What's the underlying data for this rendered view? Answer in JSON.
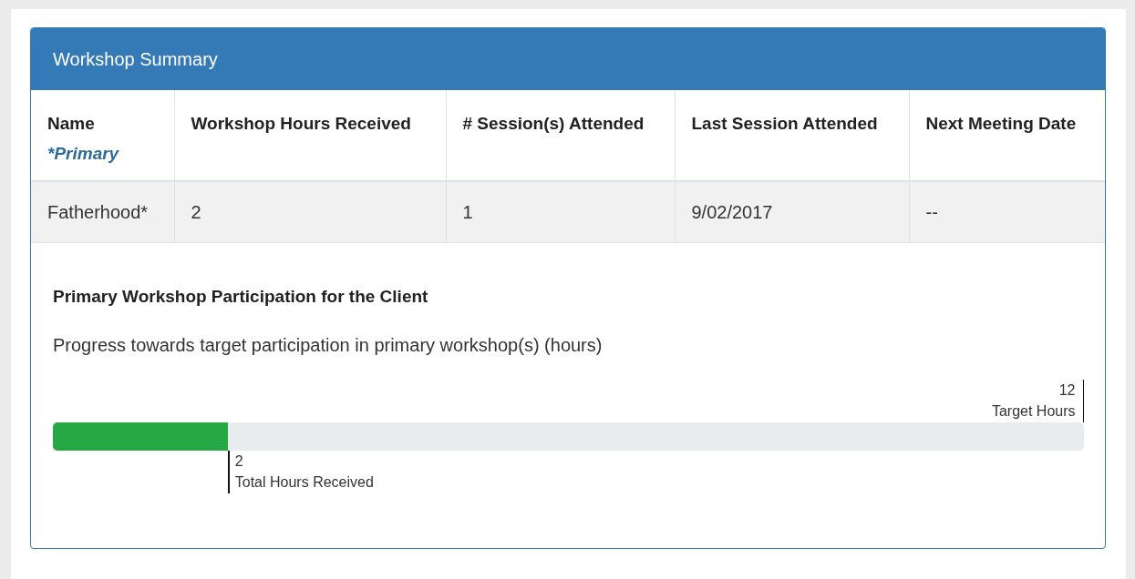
{
  "panel": {
    "title": "Workshop Summary"
  },
  "table": {
    "columns": [
      {
        "label": "Name",
        "note": "*Primary"
      },
      {
        "label": "Workshop Hours Received"
      },
      {
        "label": "# Session(s) Attended"
      },
      {
        "label": "Last Session Attended"
      },
      {
        "label": "Next Meeting Date"
      }
    ],
    "rows": [
      {
        "cells": [
          "Fatherhood*",
          "2",
          "1",
          "9/02/2017",
          "--"
        ]
      }
    ]
  },
  "participation": {
    "heading": "Primary Workshop Participation for the Client",
    "description": "Progress towards target participation in primary workshop(s) (hours)",
    "level": 0.17,
    "target": {
      "value": "12",
      "label": "Target Hours"
    },
    "received": {
      "value": "2",
      "label": "Total Hours Received"
    }
  }
}
